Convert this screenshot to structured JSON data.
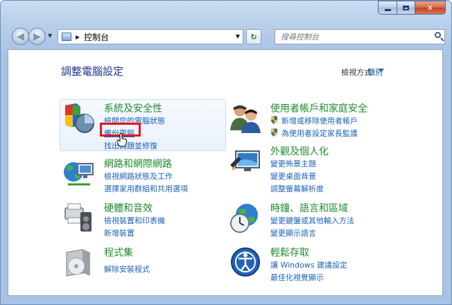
{
  "window": {
    "nav": {
      "breadcrumb": "控制台",
      "search_placeholder": "搜尋控制台"
    }
  },
  "main": {
    "title": "調整電腦設定",
    "view_by_label": "檢視方式:",
    "view_by_value": "類別"
  },
  "categories": [
    {
      "title": "系統及安全性",
      "icon": "system-security-icon",
      "links": [
        "檢閱您的電腦狀態",
        "備份電腦",
        "找出問題並修復"
      ]
    },
    {
      "title": "使用者帳戶和家庭安全",
      "icon": "users-icon",
      "links": [
        "新增或移除使用者帳戶",
        "為使用者設定家長監護"
      ]
    },
    {
      "title": "網路和網際網路",
      "icon": "network-icon",
      "links": [
        "檢視網路狀態及工作",
        "選擇家用群組和共用選項"
      ]
    },
    {
      "title": "外觀及個人化",
      "icon": "appearance-icon",
      "links": [
        "變更佈景主題",
        "變更桌面背景",
        "調整螢幕解析度"
      ]
    },
    {
      "title": "硬體和音效",
      "icon": "hardware-sound-icon",
      "links": [
        "檢視裝置和印表機",
        "新增裝置"
      ]
    },
    {
      "title": "時鐘、語言和區域",
      "icon": "clock-language-icon",
      "links": [
        "變更鍵盤或其他輸入方法",
        "變更顯示語言"
      ]
    },
    {
      "title": "程式集",
      "icon": "programs-icon",
      "links": [
        "解除安裝程式"
      ]
    },
    {
      "title": "輕鬆存取",
      "icon": "ease-of-access-icon",
      "links": [
        "讓 Windows 建議設定",
        "最佳化視覺顯示"
      ]
    }
  ],
  "colors": {
    "category_title": "#1f8a30",
    "link": "#1d62b8",
    "heading": "#1e3287",
    "highlight_box": "#e8141b"
  }
}
